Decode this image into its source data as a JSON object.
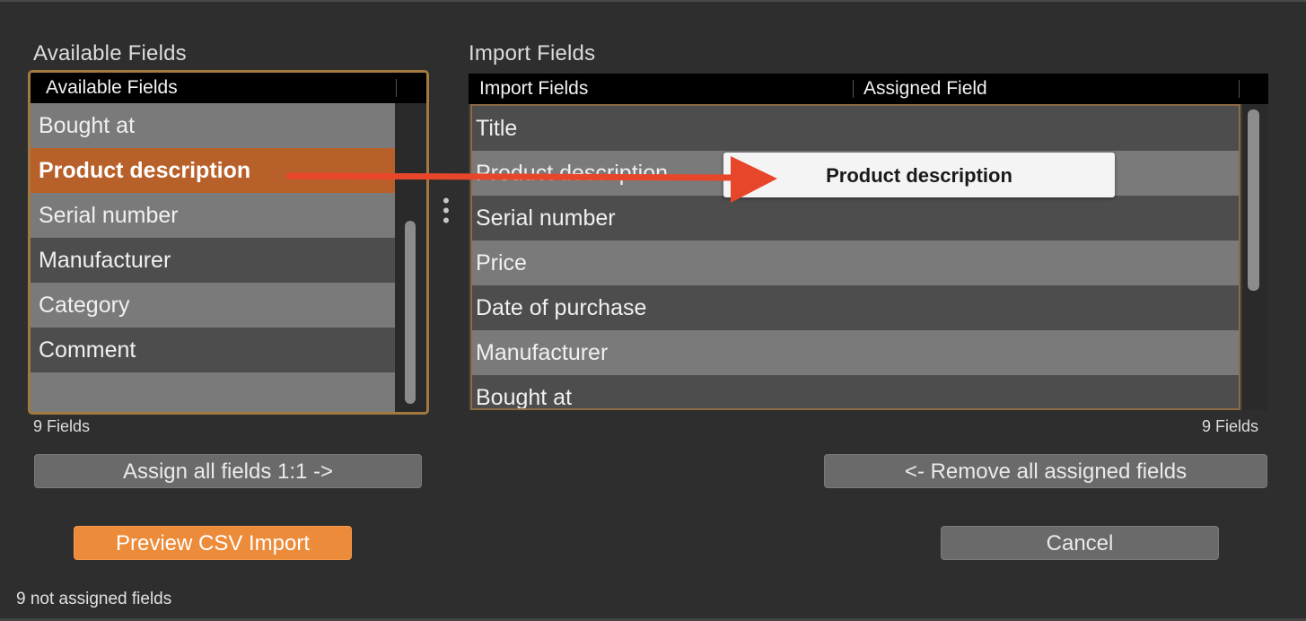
{
  "left": {
    "title": "Available Fields",
    "header": "Available Fields",
    "rows": [
      "Bought at",
      "Product description",
      "Serial number",
      "Manufacturer",
      "Category",
      "Comment",
      ""
    ],
    "selected_index": 1,
    "count": "9 Fields"
  },
  "right": {
    "title": "Import Fields",
    "header_import": "Import Fields",
    "header_assigned": "Assigned Field",
    "rows": [
      "Title",
      "Product description",
      "Serial number",
      "Price",
      "Date of purchase",
      "Manufacturer",
      "Bought at"
    ],
    "count": "9 Fields"
  },
  "drag_chip": "Product description",
  "buttons": {
    "assign_all": "Assign all fields 1:1 ->",
    "remove_all": "<- Remove all assigned fields",
    "preview": "Preview CSV Import",
    "cancel": "Cancel"
  },
  "status": "9 not assigned fields",
  "colors": {
    "selected_row": "#b8602a",
    "primary_button": "#ec8b3a",
    "panel_border": "#a2793f",
    "arrow": "#e8462a"
  }
}
